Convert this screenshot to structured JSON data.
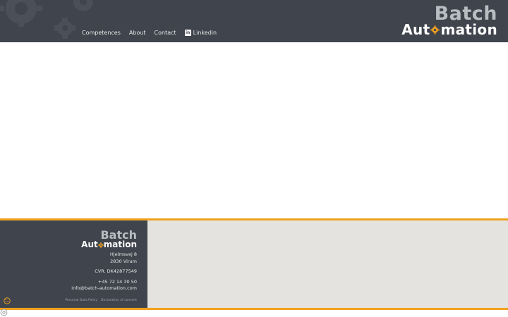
{
  "header": {
    "nav": [
      {
        "label": "Competences"
      },
      {
        "label": "About"
      },
      {
        "label": "Contact"
      },
      {
        "label": "Linkedin",
        "icon": "linkedin-icon"
      }
    ],
    "logo": {
      "line1": "Batch",
      "line2a": "Aut",
      "line2b": "mation"
    }
  },
  "footer": {
    "logo": {
      "line1": "Batch",
      "line2a": "Aut",
      "line2b": "mation"
    },
    "address1": "Hjelmsvej 8",
    "address2": "2830 Virum",
    "cvr": "CVR. DK42877549",
    "phone": "+45 72 14 30 50",
    "email": "info@batch-automation.com",
    "links": [
      "Personal Data Policy",
      "Declaration of consent"
    ]
  },
  "colors": {
    "header_bg": "#3f444d",
    "accent": "#f0a21f",
    "footer_light": "#e5e3df"
  }
}
